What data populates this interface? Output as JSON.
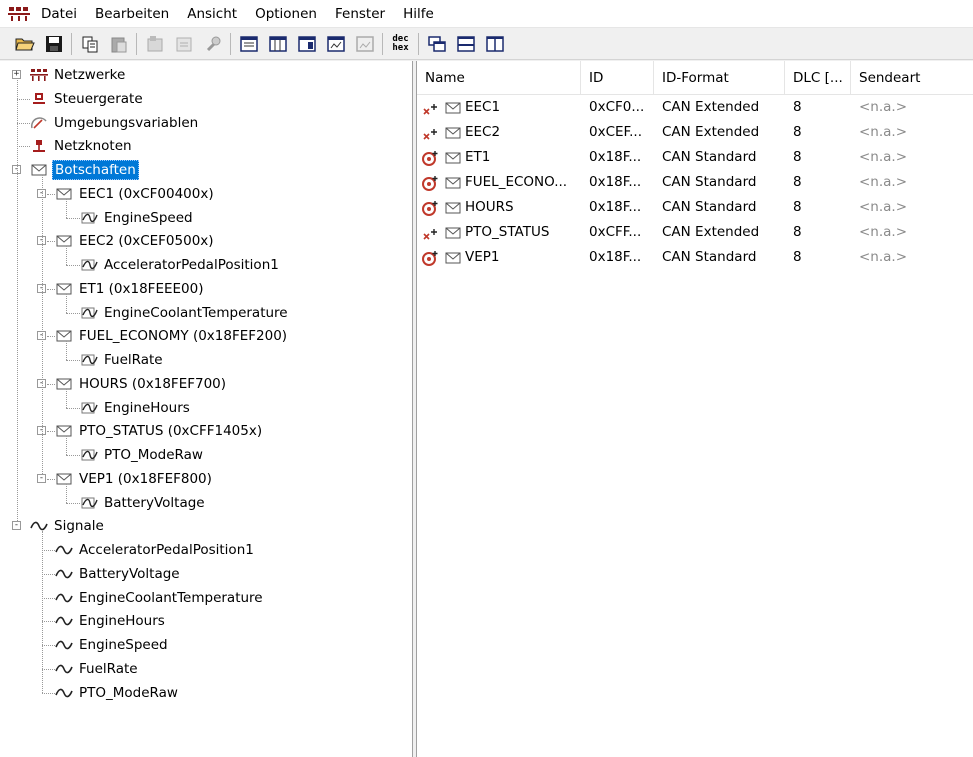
{
  "menu": [
    "Datei",
    "Bearbeiten",
    "Ansicht",
    "Optionen",
    "Fenster",
    "Hilfe"
  ],
  "toolbar": {
    "buttons": [
      "open-folder-icon",
      "save-icon",
      "copy-icon",
      "paste-icon",
      "properties-icon",
      "edit-icon",
      "tool-icon",
      "view1-icon",
      "view2-icon",
      "view3-icon",
      "view4-icon",
      "view5-icon",
      "dec-hex-icon",
      "cascade-icon",
      "tile-horizontal-icon",
      "tile-vertical-icon"
    ],
    "dec_hex": {
      "top": "dec",
      "bottom": "hex"
    }
  },
  "tree": {
    "roots": [
      {
        "label": "Netzwerke",
        "icon": "network-icon"
      },
      {
        "label": "Steuergerate",
        "icon": "ecu-icon"
      },
      {
        "label": "Umgebungsvariablen",
        "icon": "env-var-icon"
      },
      {
        "label": "Netzknoten",
        "icon": "node-icon"
      },
      {
        "label": "Botschaften",
        "icon": "envelope-icon"
      }
    ],
    "messages": [
      {
        "label": "EEC1 (0xCF00400x)",
        "signal": "EngineSpeed"
      },
      {
        "label": "EEC2 (0xCEF0500x)",
        "signal": "AcceleratorPedalPosition1"
      },
      {
        "label": "ET1 (0x18FEEE00)",
        "signal": "EngineCoolantTemperature"
      },
      {
        "label": "FUEL_ECONOMY (0x18FEF200)",
        "signal": "FuelRate"
      },
      {
        "label": "HOURS (0x18FEF700)",
        "signal": "EngineHours"
      },
      {
        "label": "PTO_STATUS (0xCFF1405x)",
        "signal": "PTO_ModeRaw"
      },
      {
        "label": "VEP1 (0x18FEF800)",
        "signal": "BatteryVoltage"
      }
    ],
    "signals_root": "Signale",
    "signals": [
      "AcceleratorPedalPosition1",
      "BatteryVoltage",
      "EngineCoolantTemperature",
      "EngineHours",
      "EngineSpeed",
      "FuelRate",
      "PTO_ModeRaw"
    ]
  },
  "grid": {
    "columns": [
      "Name",
      "ID",
      "ID-Format",
      "DLC [...",
      "Sendeart"
    ],
    "rows": [
      {
        "type": "extended",
        "name": "EEC1",
        "id": "0xCF0...",
        "format": "CAN Extended",
        "dlc": "8",
        "send": "<n.a.>"
      },
      {
        "type": "extended",
        "name": "EEC2",
        "id": "0xCEF...",
        "format": "CAN Extended",
        "dlc": "8",
        "send": "<n.a.>"
      },
      {
        "type": "standard",
        "name": "ET1",
        "id": "0x18F...",
        "format": "CAN Standard",
        "dlc": "8",
        "send": "<n.a.>"
      },
      {
        "type": "standard",
        "name": "FUEL_ECONO...",
        "id": "0x18F...",
        "format": "CAN Standard",
        "dlc": "8",
        "send": "<n.a.>"
      },
      {
        "type": "standard",
        "name": "HOURS",
        "id": "0x18F...",
        "format": "CAN Standard",
        "dlc": "8",
        "send": "<n.a.>"
      },
      {
        "type": "extended",
        "name": "PTO_STATUS",
        "id": "0xCFF...",
        "format": "CAN Extended",
        "dlc": "8",
        "send": "<n.a.>"
      },
      {
        "type": "standard",
        "name": "VEP1",
        "id": "0x18F...",
        "format": "CAN Standard",
        "dlc": "8",
        "send": "<n.a.>"
      }
    ]
  },
  "colors": {
    "selection": "#0078d7",
    "network": "#8b1a1a",
    "standard_icon": "#c0392b"
  }
}
